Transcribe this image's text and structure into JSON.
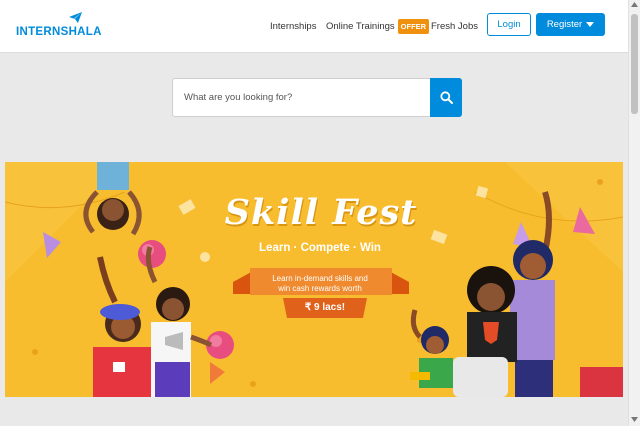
{
  "header": {
    "logo_text": "INTERNSHALA",
    "nav": [
      {
        "label": "Internships"
      },
      {
        "label": "Online Trainings",
        "badge": "OFFER"
      },
      {
        "label": "Fresh Jobs"
      }
    ],
    "login_label": "Login",
    "register_label": "Register"
  },
  "search": {
    "placeholder": "What are you looking for?",
    "value": ""
  },
  "banner": {
    "title": "Skill Fest",
    "subtitle": "Learn · Compete · Win",
    "promo_line1": "Learn in-demand skills and",
    "promo_line2": "win cash rewards worth",
    "promo_amount": "₹ 9 lacs!"
  },
  "colors": {
    "brand_blue": "#008bdc",
    "offer_orange": "#f0900f",
    "banner_yellow": "#f7bd2e",
    "page_grey": "#e9e9e9"
  },
  "icons": [
    "paper-plane-icon",
    "caret-down-icon",
    "search-icon",
    "scroll-up-icon",
    "scroll-down-icon"
  ]
}
